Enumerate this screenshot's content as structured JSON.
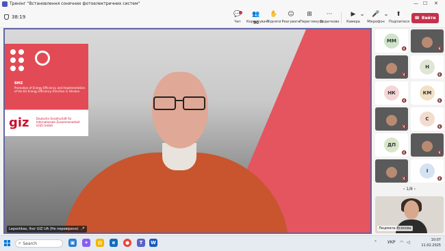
{
  "window": {
    "title": "Тренінг \"Встановлення сонячних фотоелектричних систем\""
  },
  "meeting": {
    "timer": "38:19"
  },
  "toolbar": {
    "chat": "Чат",
    "participants": "Користувачі",
    "participants_count": "90",
    "raise": "Підняти",
    "react": "Реагувати",
    "view": "Переглянути",
    "more": "Додатково",
    "camera": "Камера",
    "mic": "Мікрофон",
    "share": "Поділитися",
    "leave": "Вийти"
  },
  "stage": {
    "speaker_name": "Leposhkas, Ihor GIZ UA (Не перевірено)",
    "bmz_title": "BMZ",
    "bmz_desc": "Promotion of Energy Efficiency and Implementation of the EU Energy Efficiency Directive in Ukraine",
    "giz_logo": "giz",
    "giz_desc": "Deutsche Gesellschaft für Internationale Zusammenarbeit (GIZ) GmbH"
  },
  "participants": {
    "tiles": [
      {
        "type": "avatar",
        "initials": "MM",
        "color": "#cfe3c8"
      },
      {
        "type": "video"
      },
      {
        "type": "video"
      },
      {
        "type": "avatar",
        "initials": "Н",
        "color": "#dfe6d4"
      },
      {
        "type": "avatar",
        "initials": "НК",
        "color": "#f4d6d6"
      },
      {
        "type": "avatar",
        "initials": "КМ",
        "color": "#f2e0c4"
      },
      {
        "type": "video"
      },
      {
        "type": "avatar",
        "initials": "С",
        "color": "#f2dccd"
      },
      {
        "type": "avatar",
        "initials": "ДП",
        "color": "#d9e6c9"
      },
      {
        "type": "video"
      },
      {
        "type": "video"
      },
      {
        "type": "avatar",
        "initials": "І",
        "color": "#d4e2f2"
      }
    ],
    "page": "1/8",
    "self_name": "Людмила Всякова"
  },
  "taskbar": {
    "search": "Search",
    "lang": "УКР",
    "time": "10:07",
    "date": "11.02.2025"
  },
  "colors": {
    "accent": "#6264a7",
    "leave": "#c4314b",
    "brand_red": "#e24b55"
  }
}
